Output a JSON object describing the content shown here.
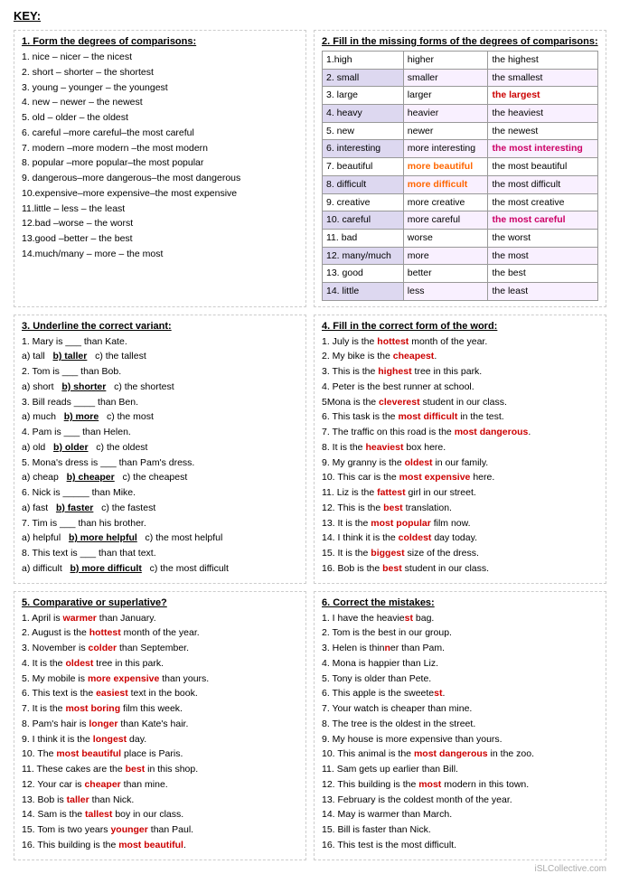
{
  "key": "KEY:",
  "section1": {
    "title": "1. Form the degrees of comparisons:",
    "items": [
      "1. nice – nicer – the nicest",
      "2. short – shorter – the shortest",
      "3. young – younger – the youngest",
      "4. new – newer – the newest",
      "5. old – older – the oldest",
      "6. careful –more careful–the most careful",
      "7. modern –more modern –the most modern",
      "8. popular –more popular–the most popular",
      "9. dangerous–more dangerous–the most dangerous",
      "10.expensive–more expensive–the most expensive",
      "11.little – less – the least",
      "12.bad –worse – the worst",
      "13.good –better – the best",
      "14.much/many – more – the most"
    ]
  },
  "section2": {
    "title": "2. Fill in the missing forms of the degrees of comparisons:",
    "rows": [
      {
        "base": "1.high",
        "comp": "higher",
        "superl": "the highest",
        "comp_color": "",
        "superl_color": ""
      },
      {
        "base": "2. small",
        "comp": "smaller",
        "superl": "the smallest",
        "comp_color": "",
        "superl_color": ""
      },
      {
        "base": "3. large",
        "comp": "larger",
        "superl": "the largest",
        "comp_color": "",
        "superl_color": "red"
      },
      {
        "base": "4. heavy",
        "comp": "heavier",
        "superl": "the heaviest",
        "comp_color": "",
        "superl_color": ""
      },
      {
        "base": "5. new",
        "comp": "newer",
        "superl": "the newest",
        "comp_color": "",
        "superl_color": ""
      },
      {
        "base": "6. interesting",
        "comp": "more interesting",
        "superl": "the most interesting",
        "comp_color": "",
        "superl_color": "pink"
      },
      {
        "base": "7. beautiful",
        "comp": "more beautiful",
        "superl": "the most beautiful",
        "comp_color": "orange",
        "superl_color": ""
      },
      {
        "base": "8. difficult",
        "comp": "more difficult",
        "superl": "the most difficult",
        "comp_color": "orange",
        "superl_color": ""
      },
      {
        "base": "9. creative",
        "comp": "more creative",
        "superl": "the most creative",
        "comp_color": "",
        "superl_color": ""
      },
      {
        "base": "10. careful",
        "comp": "more careful",
        "superl": "the most careful",
        "comp_color": "",
        "superl_color": "pink"
      },
      {
        "base": "11. bad",
        "comp": "worse",
        "superl": "the worst",
        "comp_color": "",
        "superl_color": ""
      },
      {
        "base": "12. many/much",
        "comp": "more",
        "superl": "the most",
        "comp_color": "",
        "superl_color": ""
      },
      {
        "base": "13. good",
        "comp": "better",
        "superl": "the best",
        "comp_color": "",
        "superl_color": ""
      },
      {
        "base": "14. little",
        "comp": "less",
        "superl": "the least",
        "comp_color": "",
        "superl_color": ""
      }
    ]
  },
  "section3": {
    "title": "3. Underline the correct variant:",
    "items": [
      "1. Mary is ___ than Kate.",
      "a) tall   b) taller   c) the tallest",
      "2. Tom is ___ than Bob.",
      "a) short   b) shorter   c) the shortest",
      "3. Bill reads ____ than Ben.",
      "a) much   b) more   c) the most",
      "4. Pam is ___ than Helen.",
      "a) old   b) older   c) the oldest",
      "5. Mona's dress is ___ than Pam's dress.",
      "a) cheap   b) cheaper   c) the cheapest",
      "6. Nick is _____ than Mike.",
      "a) fast   b) faster   c) the fastest",
      "7. Tim is ___ than his brother.",
      "a) helpful   b) more helpful   c) the most helpful",
      "8. This text is ___ than that text.",
      "a) difficult   b) more difficult   c) the most difficult"
    ]
  },
  "section4": {
    "title": "4. Fill in the correct form of the word:",
    "items": [
      {
        "text": "1. July is the ",
        "answer": "hottest",
        "rest": " month of the year."
      },
      {
        "text": "2. My bike is the ",
        "answer": "cheapest",
        "rest": "."
      },
      {
        "text": "3. This is the ",
        "answer": "highest",
        "rest": " tree in this park."
      },
      {
        "text": "4. Peter is the best runner at school."
      },
      {
        "text": "5Mona is the ",
        "answer": "cleverest",
        "rest": " student in our class."
      },
      {
        "text": "6. This task is the ",
        "answer": "most difficult",
        "rest": " in the test."
      },
      {
        "text": "7. The traffic on this road is the ",
        "answer": "most dangerous",
        "rest": "."
      },
      {
        "text": "8. It is the ",
        "answer": "heaviest",
        "rest": " box here."
      },
      {
        "text": "9. My granny is the ",
        "answer": "oldest",
        "rest": " in our family."
      },
      {
        "text": "10. This car is the ",
        "answer": "most expensive",
        "rest": " here."
      },
      {
        "text": "11. Liz is the ",
        "answer": "fattest",
        "rest": " girl in our street."
      },
      {
        "text": "12. This is the ",
        "answer": "best",
        "rest": " translation."
      },
      {
        "text": "13. It is the ",
        "answer": "most popular",
        "rest": " film now."
      },
      {
        "text": "14. I think it is the ",
        "answer": "coldest",
        "rest": " day today."
      },
      {
        "text": "15. It is the ",
        "answer": "biggest",
        "rest": " size of the dress."
      },
      {
        "text": "16. Bob is the ",
        "answer": "best",
        "rest": " student in our class."
      }
    ]
  },
  "section5": {
    "title": "5. Comparative or superlative?",
    "items": [
      {
        "text": "1. April is ",
        "answer": "warmer",
        "rest": " than January."
      },
      {
        "text": "2. August is the ",
        "answer": "hottest",
        "rest": " month of the year."
      },
      {
        "text": "3. November is ",
        "answer": "colder",
        "rest": " than September."
      },
      {
        "text": "4. It is the ",
        "answer": "oldest",
        "rest": " tree in this park."
      },
      {
        "text": "5. My mobile is ",
        "answer": "more expensive",
        "rest": " than yours."
      },
      {
        "text": "6. This text is the ",
        "answer": "easiest",
        "rest": " text in the book."
      },
      {
        "text": "7. It is the ",
        "answer": "most boring",
        "rest": " film this week."
      },
      {
        "text": "8. Pam's hair is ",
        "answer": "longer",
        "rest": " than Kate's hair."
      },
      {
        "text": "9. I think it is the ",
        "answer": "longest",
        "rest": " day."
      },
      {
        "text": "10. The ",
        "answer": "most beautiful",
        "rest": " place is Paris."
      },
      {
        "text": "11. These cakes are the ",
        "answer": "best",
        "rest": " in this shop."
      },
      {
        "text": "12. Your car is ",
        "answer": "cheaper",
        "rest": " than mine."
      },
      {
        "text": "13. Bob is ",
        "answer": "taller",
        "rest": " than Nick."
      },
      {
        "text": "14. Sam is the ",
        "answer": "tallest",
        "rest": " boy in our class."
      },
      {
        "text": "15. Tom is two years ",
        "answer": "younger",
        "rest": " than Paul."
      },
      {
        "text": "16. This building is the ",
        "answer": "most beautiful",
        "rest": "."
      }
    ]
  },
  "section6": {
    "title": "6. Correct the mistakes:",
    "items": [
      {
        "text": "1. I have the heaviest bag."
      },
      {
        "text": "2. Tom is the best in our group."
      },
      {
        "text": "3. Helen is thinner than Pam."
      },
      {
        "text": "4. Mona is happier than Liz."
      },
      {
        "text": "5. Tony is older than Pete."
      },
      {
        "text": "6. This apple is the sweetest."
      },
      {
        "text": "7. Your watch is cheaper than mine."
      },
      {
        "text": "8. The tree is the oldest in the street."
      },
      {
        "text": "9. My house is more expensive than yours."
      },
      {
        "text": "10. This animal is the most dangerous in the zoo."
      },
      {
        "text": "11. Sam gets up earlier than Bill."
      },
      {
        "text": "12. This building is the most modern in this town."
      },
      {
        "text": "13. February is the coldest month of the year."
      },
      {
        "text": "14. May is warmer than March."
      },
      {
        "text": "15. Bill is faster than Nick."
      },
      {
        "text": "16. This test is the most difficult."
      }
    ]
  },
  "watermark": "iSLCollective.com"
}
